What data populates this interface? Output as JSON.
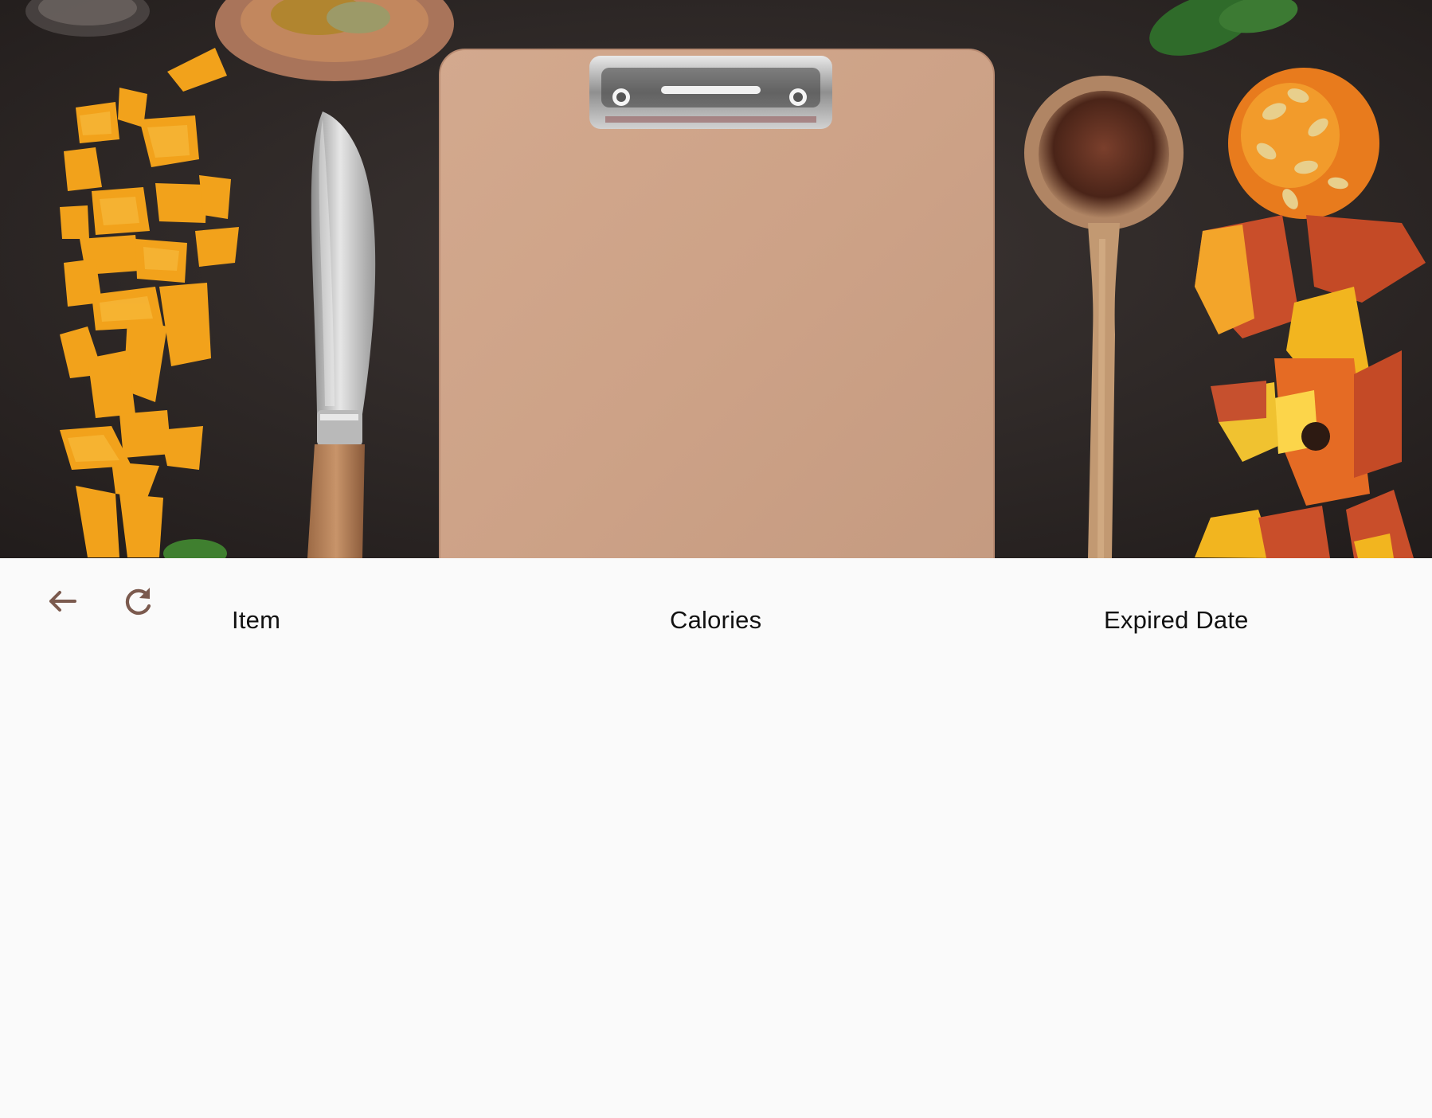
{
  "hero": {
    "image_description_icon": "kitchen-flatlay-image"
  },
  "toolbar": {
    "back_icon": "arrow-left-icon",
    "refresh_icon": "refresh-icon"
  },
  "table": {
    "columns": [
      "Item",
      "Calories",
      "Expired Date"
    ],
    "rows": []
  },
  "colors": {
    "icon": "#7b5a4e",
    "background": "#fafafa",
    "text": "#111111"
  }
}
